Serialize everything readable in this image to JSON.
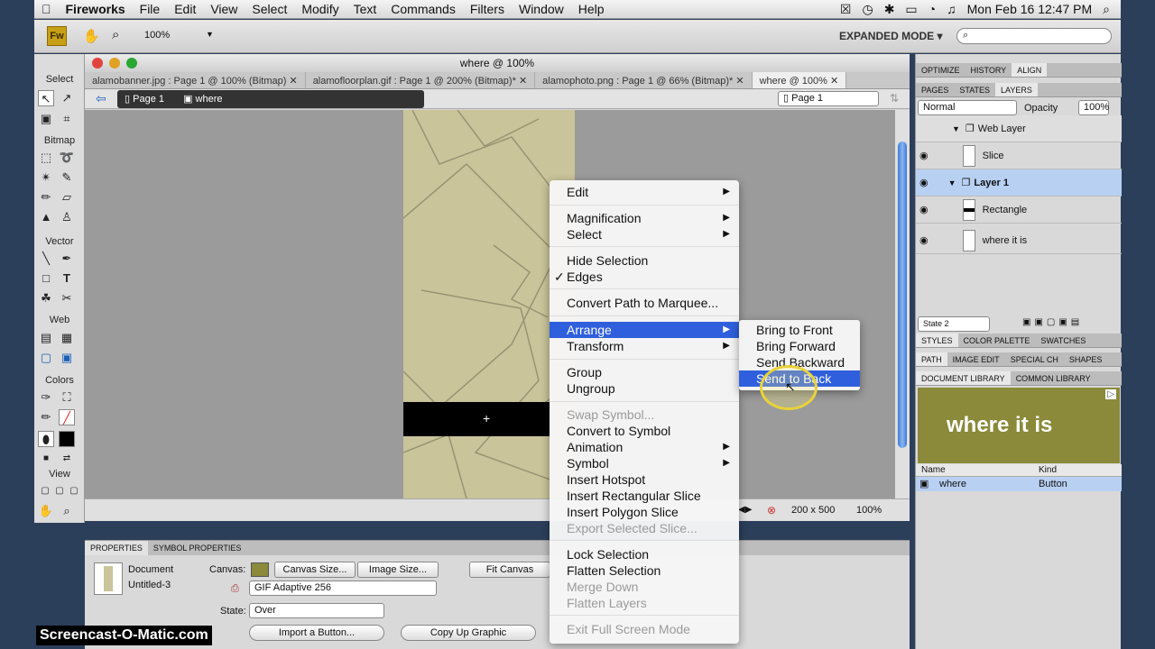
{
  "menubar": {
    "app": "Fireworks",
    "items": [
      "File",
      "Edit",
      "View",
      "Select",
      "Modify",
      "Text",
      "Commands",
      "Filters",
      "Window",
      "Help"
    ],
    "clock": "Mon Feb 16  12:47 PM"
  },
  "apptool": {
    "zoom": "100%",
    "mode": "EXPANDED MODE ▾"
  },
  "tools": {
    "sections": [
      "Select",
      "Bitmap",
      "Vector",
      "Web",
      "Colors",
      "View"
    ]
  },
  "doc": {
    "title": "where @ 100%",
    "tabs": [
      "alamobanner.jpg : Page 1 @ 100% (Bitmap)",
      "alamofloorplan.gif : Page 1 @ 200% (Bitmap)*",
      "alamophoto.png : Page 1 @ 66% (Bitmap)*",
      "where @ 100%"
    ],
    "crumb_page": "Page 1",
    "crumb_doc": "where",
    "page_select": "Page 1",
    "size": "200 x 500",
    "zoom": "100%"
  },
  "context_menu": {
    "items": [
      {
        "label": "Edit",
        "sub": true
      },
      {
        "label": "Magnification",
        "sub": true
      },
      {
        "label": "Select",
        "sub": true
      },
      {
        "label": "Hide Selection"
      },
      {
        "label": "Edges",
        "check": "✓"
      },
      {
        "label": "Convert Path to Marquee..."
      },
      {
        "label": "Arrange",
        "sub": true
      },
      {
        "label": "Transform",
        "sub": true
      },
      {
        "label": "Group"
      },
      {
        "label": "Ungroup"
      },
      {
        "label": "Swap Symbol..."
      },
      {
        "label": "Convert to Symbol"
      },
      {
        "label": "Animation",
        "sub": true
      },
      {
        "label": "Symbol",
        "sub": true
      },
      {
        "label": "Insert Hotspot"
      },
      {
        "label": "Insert Rectangular Slice"
      },
      {
        "label": "Insert Polygon Slice"
      },
      {
        "label": "Export Selected Slice..."
      },
      {
        "label": "Lock Selection"
      },
      {
        "label": "Flatten Selection"
      },
      {
        "label": "Merge Down"
      },
      {
        "label": "Flatten Layers"
      },
      {
        "label": "Exit Full Screen Mode"
      }
    ],
    "submenu": [
      "Bring to Front",
      "Bring Forward",
      "Send Backward",
      "Send to Back"
    ]
  },
  "props": {
    "tab1": "PROPERTIES",
    "tab2": "SYMBOL PROPERTIES",
    "doc_label": "Document",
    "doc_name": "Untitled-3",
    "canvas_label": "Canvas:",
    "canvas_size": "Canvas Size...",
    "image_size": "Image Size...",
    "fit_canvas": "Fit Canvas",
    "format": "GIF Adaptive 256",
    "state_label": "State:",
    "state_value": "Over",
    "import_btn": "Import a Button...",
    "copy_btn": "Copy Up Graphic"
  },
  "right": {
    "tabs1": [
      "OPTIMIZE",
      "HISTORY",
      "ALIGN"
    ],
    "tabs2": [
      "PAGES",
      "STATES",
      "LAYERS"
    ],
    "blend": "Normal",
    "opacity_label": "Opacity",
    "opacity": "100%",
    "layers": [
      {
        "name": "Web Layer"
      },
      {
        "name": "Slice"
      },
      {
        "name": "Layer 1"
      },
      {
        "name": "Rectangle"
      },
      {
        "name": "where it is"
      }
    ],
    "state_select": "State 2",
    "tabs3": [
      "STYLES",
      "COLOR PALETTE",
      "SWATCHES"
    ],
    "tabs4": [
      "PATH",
      "IMAGE EDIT",
      "SPECIAL CH",
      "SHAPES"
    ],
    "tabs5": [
      "DOCUMENT LIBRARY",
      "COMMON LIBRARY"
    ],
    "preview_text": "where it is",
    "lib_col_name": "Name",
    "lib_col_kind": "Kind",
    "lib_row_name": "where",
    "lib_row_kind": "Button"
  },
  "watermark": "Screencast-O-Matic.com",
  "colors": {
    "accent": "#2f5fdc",
    "canvas_tan": "#c9c49a",
    "preview_olive": "#8a8a3a"
  }
}
